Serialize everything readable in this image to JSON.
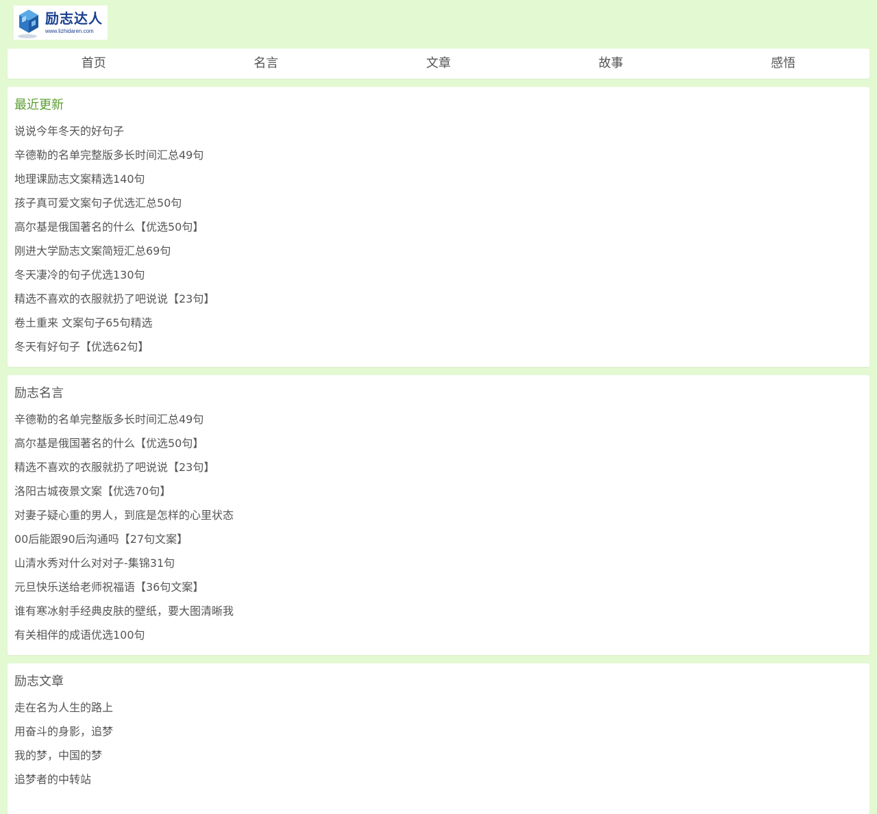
{
  "header": {
    "logo_title": "励志达人",
    "logo_url": "www.lizhidaren.com"
  },
  "nav": {
    "items": [
      {
        "label": "首页"
      },
      {
        "label": "名言"
      },
      {
        "label": "文章"
      },
      {
        "label": "故事"
      },
      {
        "label": "感悟"
      }
    ]
  },
  "sections": [
    {
      "title": "最近更新",
      "items": [
        "说说今年冬天的好句子",
        "辛德勒的名单完整版多长时间汇总49句",
        "地理课励志文案精选140句",
        "孩子真可爱文案句子优选汇总50句",
        "高尔基是俄国著名的什么【优选50句】",
        "刚进大学励志文案简短汇总69句",
        "冬天凄冷的句子优选130句",
        "精选不喜欢的衣服就扔了吧说说【23句】",
        "卷土重来 文案句子65句精选",
        "冬天有好句子【优选62句】"
      ]
    },
    {
      "title": "励志名言",
      "items": [
        "辛德勒的名单完整版多长时间汇总49句",
        "高尔基是俄国著名的什么【优选50句】",
        "精选不喜欢的衣服就扔了吧说说【23句】",
        "洛阳古城夜景文案【优选70句】",
        "对妻子疑心重的男人，到底是怎样的心里状态",
        "00后能跟90后沟通吗【27句文案】",
        "山清水秀对什么对对子-集锦31句",
        "元旦快乐送给老师祝福语【36句文案】",
        "谁有寒冰射手经典皮肤的壁纸，要大图清晰我",
        "有关相伴的成语优选100句"
      ]
    },
    {
      "title": "励志文章",
      "items": [
        "走在名为人生的路上",
        "用奋斗的身影，追梦",
        "我的梦，中国的梦",
        "追梦者的中转站"
      ]
    }
  ],
  "colors": {
    "page_background": "#e3f9d2",
    "accent_title": "#5a9e2f",
    "logo_blue": "#1a3f8f"
  }
}
